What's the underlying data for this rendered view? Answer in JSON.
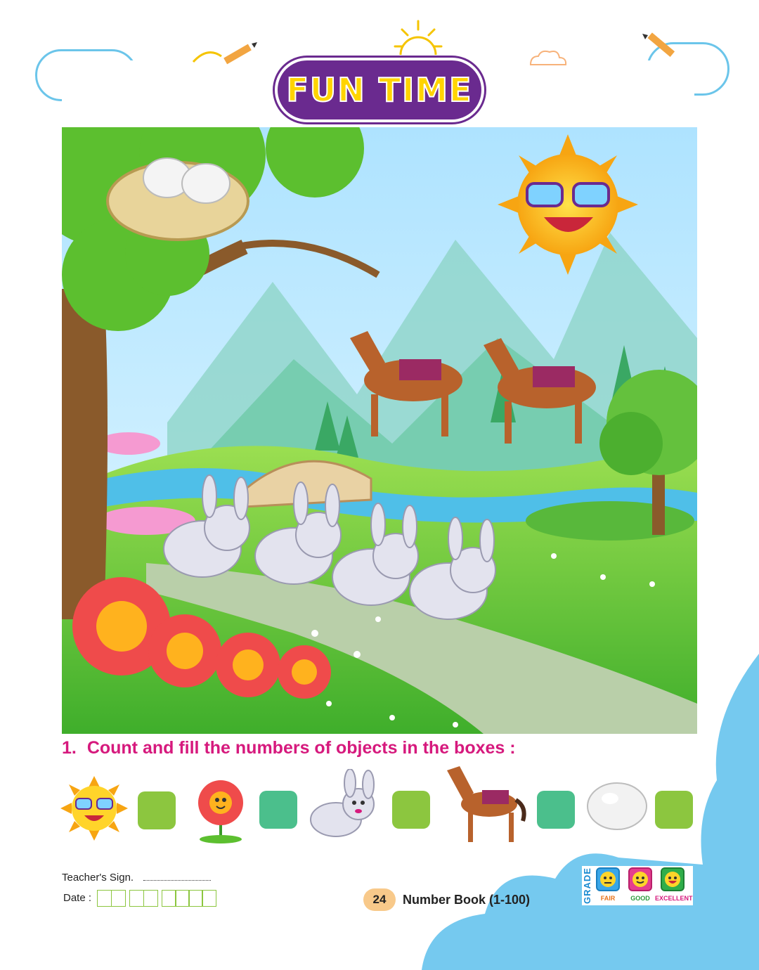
{
  "header": {
    "title": "FUN TIME"
  },
  "question": {
    "number": "1.",
    "text": "Count and fill the numbers of objects in the boxes :"
  },
  "count_items": [
    {
      "icon": "sun-icon",
      "box_color": "#8cc63f"
    },
    {
      "icon": "flower-icon",
      "box_color": "#4bbf8c"
    },
    {
      "icon": "rabbit-icon",
      "box_color": "#8cc63f"
    },
    {
      "icon": "horse-icon",
      "box_color": "#4bbf8c"
    },
    {
      "icon": "egg-icon",
      "box_color": "#8cc63f"
    }
  ],
  "footer": {
    "teacher_sign_label": "Teacher's Sign.",
    "date_label": "Date :",
    "page_number": "24",
    "book_title": "Number Book (1-100)",
    "grade_label": "GRADE",
    "grades": [
      "FAIR",
      "GOOD",
      "EXCELLENT"
    ]
  },
  "colors": {
    "question": "#d6197d",
    "box_green": "#8cc63f",
    "box_teal": "#4bbf8c",
    "cloud_blue": "#6bc5ea"
  }
}
